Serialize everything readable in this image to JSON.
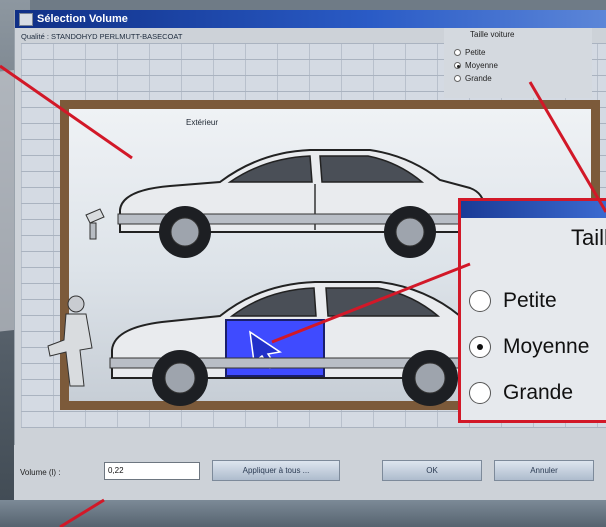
{
  "window": {
    "title": "Sélection Volume",
    "quality": "Qualité : STANDOHYD PERLMUTT-BASECOAT"
  },
  "scene": {
    "exterior_label": "Extérieur"
  },
  "car_size": {
    "title": "Taille voiture",
    "options": [
      {
        "label": "Petite",
        "selected": false
      },
      {
        "label": "Moyenne",
        "selected": true
      },
      {
        "label": "Grande",
        "selected": false
      }
    ]
  },
  "zoom": {
    "title": "Taille voiture",
    "options": [
      {
        "label": "Petite",
        "selected": false
      },
      {
        "label": "Moyenne",
        "selected": true
      },
      {
        "label": "Grande",
        "selected": false
      }
    ]
  },
  "volume": {
    "label": "Volume (l) :",
    "value": "0,22"
  },
  "buttons": {
    "apply": "Appliquer à tous ...",
    "ok": "OK",
    "cancel": "Annuler"
  },
  "colors": {
    "accent_red": "#d21828",
    "title_blue": "#1a3b96",
    "selected_panel": "#3f4bff"
  }
}
